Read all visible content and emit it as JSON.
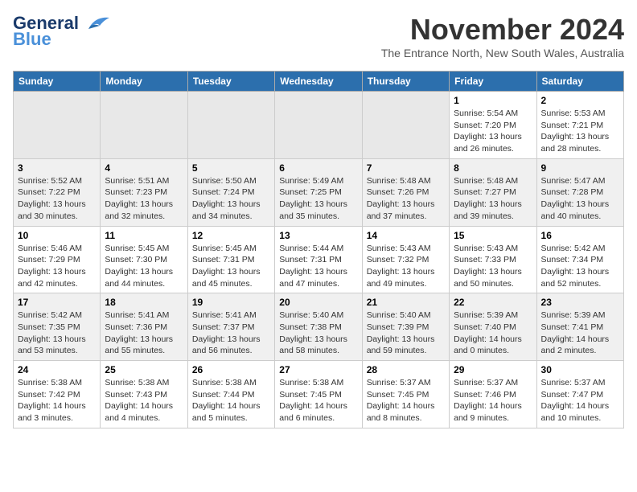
{
  "logo": {
    "general": "General",
    "blue": "Blue"
  },
  "header": {
    "month": "November 2024",
    "location": "The Entrance North, New South Wales, Australia"
  },
  "weekdays": [
    "Sunday",
    "Monday",
    "Tuesday",
    "Wednesday",
    "Thursday",
    "Friday",
    "Saturday"
  ],
  "weeks": [
    [
      {
        "day": "",
        "info": ""
      },
      {
        "day": "",
        "info": ""
      },
      {
        "day": "",
        "info": ""
      },
      {
        "day": "",
        "info": ""
      },
      {
        "day": "",
        "info": ""
      },
      {
        "day": "1",
        "info": "Sunrise: 5:54 AM\nSunset: 7:20 PM\nDaylight: 13 hours and 26 minutes."
      },
      {
        "day": "2",
        "info": "Sunrise: 5:53 AM\nSunset: 7:21 PM\nDaylight: 13 hours and 28 minutes."
      }
    ],
    [
      {
        "day": "3",
        "info": "Sunrise: 5:52 AM\nSunset: 7:22 PM\nDaylight: 13 hours and 30 minutes."
      },
      {
        "day": "4",
        "info": "Sunrise: 5:51 AM\nSunset: 7:23 PM\nDaylight: 13 hours and 32 minutes."
      },
      {
        "day": "5",
        "info": "Sunrise: 5:50 AM\nSunset: 7:24 PM\nDaylight: 13 hours and 34 minutes."
      },
      {
        "day": "6",
        "info": "Sunrise: 5:49 AM\nSunset: 7:25 PM\nDaylight: 13 hours and 35 minutes."
      },
      {
        "day": "7",
        "info": "Sunrise: 5:48 AM\nSunset: 7:26 PM\nDaylight: 13 hours and 37 minutes."
      },
      {
        "day": "8",
        "info": "Sunrise: 5:48 AM\nSunset: 7:27 PM\nDaylight: 13 hours and 39 minutes."
      },
      {
        "day": "9",
        "info": "Sunrise: 5:47 AM\nSunset: 7:28 PM\nDaylight: 13 hours and 40 minutes."
      }
    ],
    [
      {
        "day": "10",
        "info": "Sunrise: 5:46 AM\nSunset: 7:29 PM\nDaylight: 13 hours and 42 minutes."
      },
      {
        "day": "11",
        "info": "Sunrise: 5:45 AM\nSunset: 7:30 PM\nDaylight: 13 hours and 44 minutes."
      },
      {
        "day": "12",
        "info": "Sunrise: 5:45 AM\nSunset: 7:31 PM\nDaylight: 13 hours and 45 minutes."
      },
      {
        "day": "13",
        "info": "Sunrise: 5:44 AM\nSunset: 7:31 PM\nDaylight: 13 hours and 47 minutes."
      },
      {
        "day": "14",
        "info": "Sunrise: 5:43 AM\nSunset: 7:32 PM\nDaylight: 13 hours and 49 minutes."
      },
      {
        "day": "15",
        "info": "Sunrise: 5:43 AM\nSunset: 7:33 PM\nDaylight: 13 hours and 50 minutes."
      },
      {
        "day": "16",
        "info": "Sunrise: 5:42 AM\nSunset: 7:34 PM\nDaylight: 13 hours and 52 minutes."
      }
    ],
    [
      {
        "day": "17",
        "info": "Sunrise: 5:42 AM\nSunset: 7:35 PM\nDaylight: 13 hours and 53 minutes."
      },
      {
        "day": "18",
        "info": "Sunrise: 5:41 AM\nSunset: 7:36 PM\nDaylight: 13 hours and 55 minutes."
      },
      {
        "day": "19",
        "info": "Sunrise: 5:41 AM\nSunset: 7:37 PM\nDaylight: 13 hours and 56 minutes."
      },
      {
        "day": "20",
        "info": "Sunrise: 5:40 AM\nSunset: 7:38 PM\nDaylight: 13 hours and 58 minutes."
      },
      {
        "day": "21",
        "info": "Sunrise: 5:40 AM\nSunset: 7:39 PM\nDaylight: 13 hours and 59 minutes."
      },
      {
        "day": "22",
        "info": "Sunrise: 5:39 AM\nSunset: 7:40 PM\nDaylight: 14 hours and 0 minutes."
      },
      {
        "day": "23",
        "info": "Sunrise: 5:39 AM\nSunset: 7:41 PM\nDaylight: 14 hours and 2 minutes."
      }
    ],
    [
      {
        "day": "24",
        "info": "Sunrise: 5:38 AM\nSunset: 7:42 PM\nDaylight: 14 hours and 3 minutes."
      },
      {
        "day": "25",
        "info": "Sunrise: 5:38 AM\nSunset: 7:43 PM\nDaylight: 14 hours and 4 minutes."
      },
      {
        "day": "26",
        "info": "Sunrise: 5:38 AM\nSunset: 7:44 PM\nDaylight: 14 hours and 5 minutes."
      },
      {
        "day": "27",
        "info": "Sunrise: 5:38 AM\nSunset: 7:45 PM\nDaylight: 14 hours and 6 minutes."
      },
      {
        "day": "28",
        "info": "Sunrise: 5:37 AM\nSunset: 7:45 PM\nDaylight: 14 hours and 8 minutes."
      },
      {
        "day": "29",
        "info": "Sunrise: 5:37 AM\nSunset: 7:46 PM\nDaylight: 14 hours and 9 minutes."
      },
      {
        "day": "30",
        "info": "Sunrise: 5:37 AM\nSunset: 7:47 PM\nDaylight: 14 hours and 10 minutes."
      }
    ]
  ]
}
